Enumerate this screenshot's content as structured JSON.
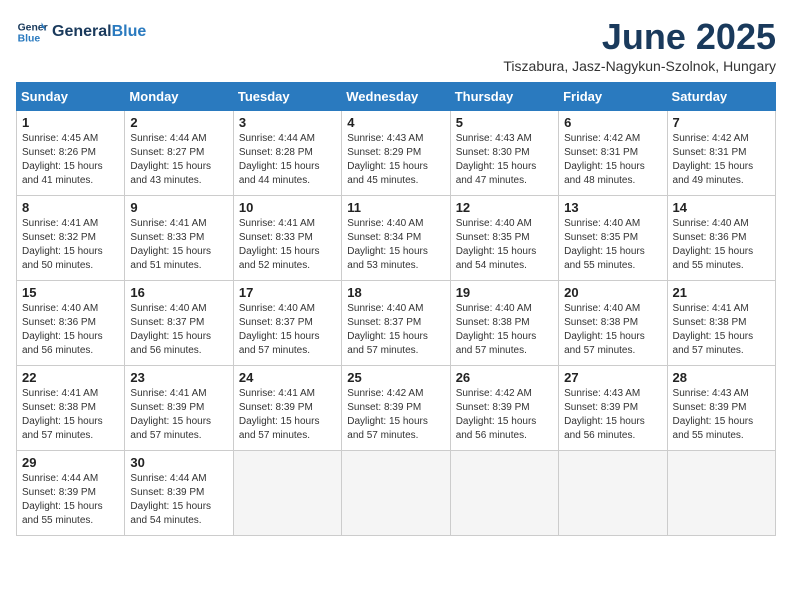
{
  "header": {
    "logo_line1": "General",
    "logo_line2": "Blue",
    "month_title": "June 2025",
    "subtitle": "Tiszabura, Jasz-Nagykun-Szolnok, Hungary"
  },
  "weekdays": [
    "Sunday",
    "Monday",
    "Tuesday",
    "Wednesday",
    "Thursday",
    "Friday",
    "Saturday"
  ],
  "weeks": [
    [
      {
        "day": "1",
        "sunrise": "4:45 AM",
        "sunset": "8:26 PM",
        "daylight": "15 hours and 41 minutes."
      },
      {
        "day": "2",
        "sunrise": "4:44 AM",
        "sunset": "8:27 PM",
        "daylight": "15 hours and 43 minutes."
      },
      {
        "day": "3",
        "sunrise": "4:44 AM",
        "sunset": "8:28 PM",
        "daylight": "15 hours and 44 minutes."
      },
      {
        "day": "4",
        "sunrise": "4:43 AM",
        "sunset": "8:29 PM",
        "daylight": "15 hours and 45 minutes."
      },
      {
        "day": "5",
        "sunrise": "4:43 AM",
        "sunset": "8:30 PM",
        "daylight": "15 hours and 47 minutes."
      },
      {
        "day": "6",
        "sunrise": "4:42 AM",
        "sunset": "8:31 PM",
        "daylight": "15 hours and 48 minutes."
      },
      {
        "day": "7",
        "sunrise": "4:42 AM",
        "sunset": "8:31 PM",
        "daylight": "15 hours and 49 minutes."
      }
    ],
    [
      {
        "day": "8",
        "sunrise": "4:41 AM",
        "sunset": "8:32 PM",
        "daylight": "15 hours and 50 minutes."
      },
      {
        "day": "9",
        "sunrise": "4:41 AM",
        "sunset": "8:33 PM",
        "daylight": "15 hours and 51 minutes."
      },
      {
        "day": "10",
        "sunrise": "4:41 AM",
        "sunset": "8:33 PM",
        "daylight": "15 hours and 52 minutes."
      },
      {
        "day": "11",
        "sunrise": "4:40 AM",
        "sunset": "8:34 PM",
        "daylight": "15 hours and 53 minutes."
      },
      {
        "day": "12",
        "sunrise": "4:40 AM",
        "sunset": "8:35 PM",
        "daylight": "15 hours and 54 minutes."
      },
      {
        "day": "13",
        "sunrise": "4:40 AM",
        "sunset": "8:35 PM",
        "daylight": "15 hours and 55 minutes."
      },
      {
        "day": "14",
        "sunrise": "4:40 AM",
        "sunset": "8:36 PM",
        "daylight": "15 hours and 55 minutes."
      }
    ],
    [
      {
        "day": "15",
        "sunrise": "4:40 AM",
        "sunset": "8:36 PM",
        "daylight": "15 hours and 56 minutes."
      },
      {
        "day": "16",
        "sunrise": "4:40 AM",
        "sunset": "8:37 PM",
        "daylight": "15 hours and 56 minutes."
      },
      {
        "day": "17",
        "sunrise": "4:40 AM",
        "sunset": "8:37 PM",
        "daylight": "15 hours and 57 minutes."
      },
      {
        "day": "18",
        "sunrise": "4:40 AM",
        "sunset": "8:37 PM",
        "daylight": "15 hours and 57 minutes."
      },
      {
        "day": "19",
        "sunrise": "4:40 AM",
        "sunset": "8:38 PM",
        "daylight": "15 hours and 57 minutes."
      },
      {
        "day": "20",
        "sunrise": "4:40 AM",
        "sunset": "8:38 PM",
        "daylight": "15 hours and 57 minutes."
      },
      {
        "day": "21",
        "sunrise": "4:41 AM",
        "sunset": "8:38 PM",
        "daylight": "15 hours and 57 minutes."
      }
    ],
    [
      {
        "day": "22",
        "sunrise": "4:41 AM",
        "sunset": "8:38 PM",
        "daylight": "15 hours and 57 minutes."
      },
      {
        "day": "23",
        "sunrise": "4:41 AM",
        "sunset": "8:39 PM",
        "daylight": "15 hours and 57 minutes."
      },
      {
        "day": "24",
        "sunrise": "4:41 AM",
        "sunset": "8:39 PM",
        "daylight": "15 hours and 57 minutes."
      },
      {
        "day": "25",
        "sunrise": "4:42 AM",
        "sunset": "8:39 PM",
        "daylight": "15 hours and 57 minutes."
      },
      {
        "day": "26",
        "sunrise": "4:42 AM",
        "sunset": "8:39 PM",
        "daylight": "15 hours and 56 minutes."
      },
      {
        "day": "27",
        "sunrise": "4:43 AM",
        "sunset": "8:39 PM",
        "daylight": "15 hours and 56 minutes."
      },
      {
        "day": "28",
        "sunrise": "4:43 AM",
        "sunset": "8:39 PM",
        "daylight": "15 hours and 55 minutes."
      }
    ],
    [
      {
        "day": "29",
        "sunrise": "4:44 AM",
        "sunset": "8:39 PM",
        "daylight": "15 hours and 55 minutes."
      },
      {
        "day": "30",
        "sunrise": "4:44 AM",
        "sunset": "8:39 PM",
        "daylight": "15 hours and 54 minutes."
      },
      null,
      null,
      null,
      null,
      null
    ]
  ]
}
